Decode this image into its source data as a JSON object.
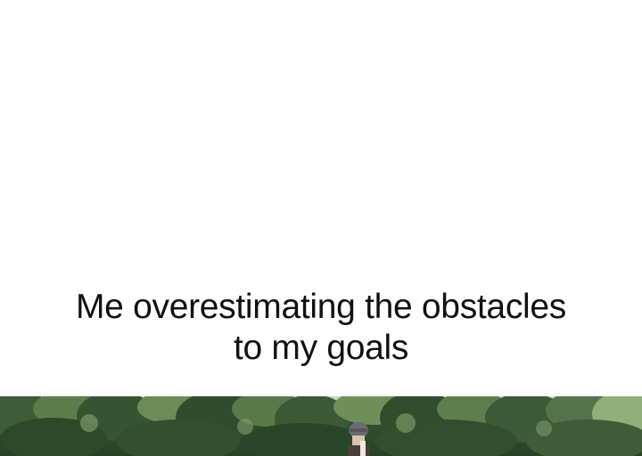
{
  "caption": {
    "line1": "Me overestimating the obstacles",
    "line2": "to my goals"
  },
  "photo": {
    "scene": "forest-trees-with-rider",
    "colors": {
      "foliage_dark": "#2c4a2a",
      "foliage_mid": "#4f7345",
      "foliage_light": "#8fb07a",
      "helmet": "#6a6a70"
    }
  }
}
